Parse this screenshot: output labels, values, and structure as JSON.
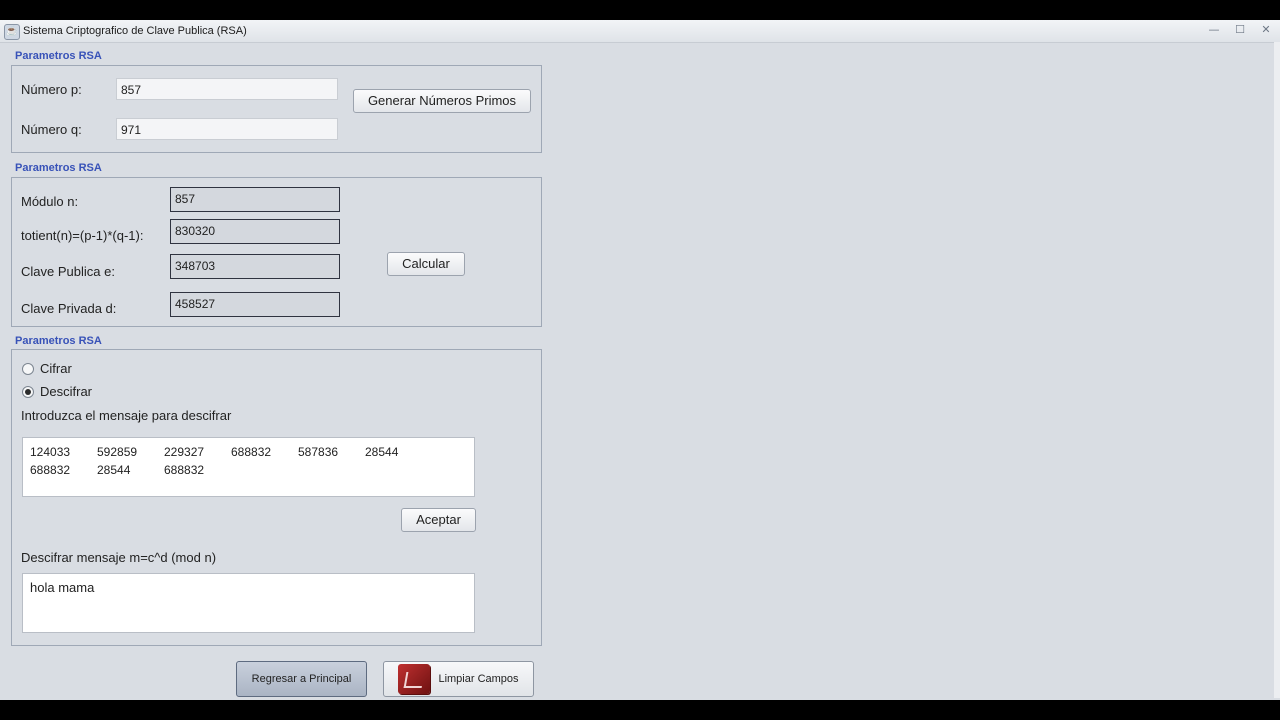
{
  "window": {
    "title": "Sistema Criptografico de Clave Publica (RSA)",
    "controls": {
      "minimize": "—",
      "maximize": "☐",
      "close": "✕"
    }
  },
  "section1": {
    "label": "Parametros RSA",
    "p_label": "Número p:",
    "p_value": "857",
    "q_label": "Número q:",
    "q_value": "971",
    "generate_button": "Generar Números Primos"
  },
  "section2": {
    "label": "Parametros RSA",
    "n_label": "Módulo n:",
    "n_value": "857",
    "totient_label": "totient(n)=(p-1)*(q-1):",
    "totient_value": "830320",
    "e_label": "Clave Publica e:",
    "e_value": "348703",
    "d_label": "Clave Privada d:",
    "d_value": "458527",
    "calc_button": "Calcular"
  },
  "section3": {
    "label": "Parametros RSA",
    "radio_cifrar": "Cifrar",
    "radio_descifrar": "Descifrar",
    "selected": "Descifrar",
    "input_prompt": "Introduzca el mensaje para descifrar",
    "cipher_line1": [
      "124033",
      "592859",
      "229327",
      "688832",
      "587836",
      "28544"
    ],
    "cipher_line2": [
      "688832",
      "28544",
      "688832"
    ],
    "accept_button": "Aceptar",
    "output_label": "Descifrar mensaje m=c^d (mod n)",
    "output_value": "hola mama"
  },
  "footer": {
    "back_button": "Regresar a Principal",
    "clear_button": "Limpiar Campos"
  },
  "icons": {
    "app": "window-app-icon",
    "clear": "book-icon"
  },
  "colors": {
    "accent": "#3852b8",
    "window_bg": "#d9dde3",
    "clear_icon": "#b02a2a"
  }
}
